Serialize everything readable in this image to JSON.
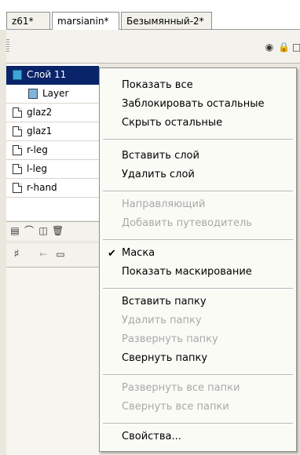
{
  "tabs": [
    {
      "label": "z61*"
    },
    {
      "label": "marsianin*"
    },
    {
      "label": "Безымянный-2*"
    }
  ],
  "header_icons": {
    "eye": "eye-icon",
    "lock": "lock-icon",
    "outline": "outline-icon"
  },
  "layers": [
    {
      "label": "Слой 11",
      "icon": "mask-layer-icon",
      "selected": true
    },
    {
      "label": "Layer",
      "icon": "masked-layer-icon",
      "selected": false
    },
    {
      "label": "glaz2",
      "icon": "layer-icon",
      "selected": false
    },
    {
      "label": "glaz1",
      "icon": "layer-icon",
      "selected": false
    },
    {
      "label": "r-leg",
      "icon": "layer-icon",
      "selected": false
    },
    {
      "label": "l-leg",
      "icon": "layer-icon",
      "selected": false
    },
    {
      "label": "r-hand",
      "icon": "layer-icon",
      "selected": false
    }
  ],
  "context_menu": {
    "items": [
      {
        "label": "Показать все",
        "enabled": true
      },
      {
        "label": "Заблокировать остальные",
        "enabled": true
      },
      {
        "label": "Скрыть остальные",
        "enabled": true
      },
      {
        "label": "Вставить слой",
        "enabled": true
      },
      {
        "label": "Удалить слой",
        "enabled": true
      },
      {
        "label": "Направляющий",
        "enabled": false
      },
      {
        "label": "Добавить путеводитель",
        "enabled": false
      },
      {
        "label": "Маска",
        "enabled": true,
        "checked": true
      },
      {
        "label": "Показать маскирование",
        "enabled": true
      },
      {
        "label": "Вставить папку",
        "enabled": true
      },
      {
        "label": "Удалить папку",
        "enabled": false
      },
      {
        "label": "Развернуть папку",
        "enabled": false
      },
      {
        "label": "Свернуть папку",
        "enabled": true
      },
      {
        "label": "Развернуть все папки",
        "enabled": false
      },
      {
        "label": "Свернуть все папки",
        "enabled": false
      },
      {
        "label": "Свойства...",
        "enabled": true
      }
    ]
  },
  "colors": {
    "selection": "#0a246a",
    "disabled_text": "#a8a8a8",
    "panel": "#f3f2ec"
  }
}
